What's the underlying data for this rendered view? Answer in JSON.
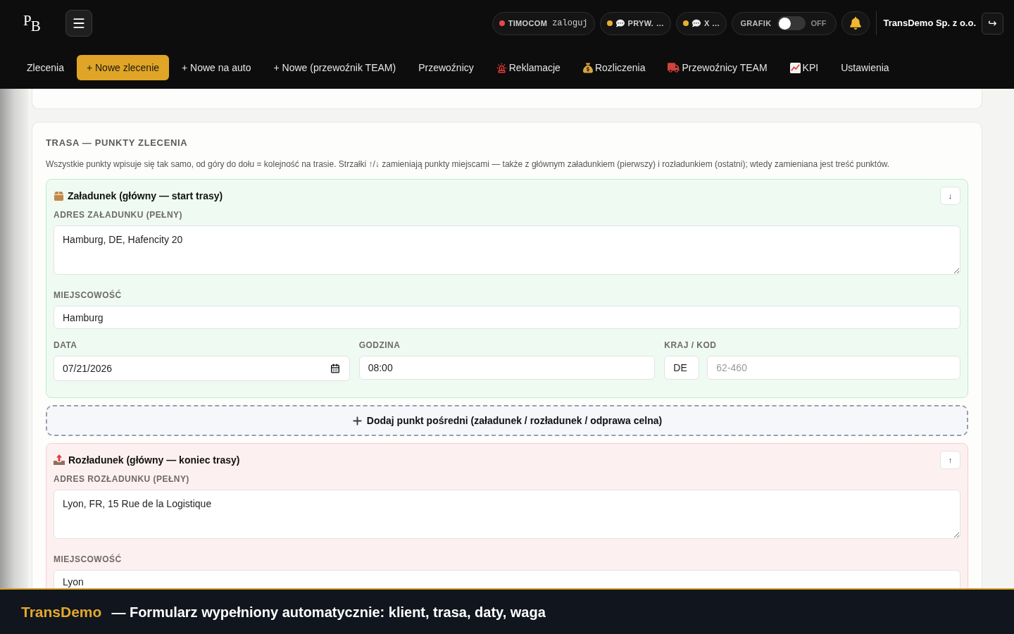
{
  "header": {
    "logo_letters": [
      "P",
      "B"
    ],
    "pills": [
      {
        "kind": "status",
        "color": "#e5484d",
        "label": "TIMOCOM",
        "value": "zaloguj"
      },
      {
        "kind": "chat",
        "color": "#e8b130",
        "label": "PRYW. …"
      },
      {
        "kind": "chat",
        "color": "#e8b130",
        "label": "X …"
      }
    ],
    "schedule": {
      "label": "GRAFIK",
      "on": false,
      "state_label": "OFF"
    },
    "company": "TransDemo Sp. z o.o.",
    "logout_glyph": "↪"
  },
  "nav": [
    {
      "kind": "plain",
      "label": "Zlecenia",
      "selected": false
    },
    {
      "kind": "plain",
      "label": "+ Nowe zlecenie",
      "selected": true
    },
    {
      "kind": "plain",
      "label": "+ Nowe na auto",
      "selected": false
    },
    {
      "kind": "plain",
      "label": "+ Nowe (przewoźnik TEAM)",
      "selected": false
    },
    {
      "kind": "plain",
      "label": "Przewoźnicy",
      "selected": false
    },
    {
      "kind": "siren",
      "label": "Reklamacje",
      "selected": false
    },
    {
      "kind": "money_bag",
      "label": "Rozliczenia",
      "selected": false
    },
    {
      "kind": "truck",
      "label": "Przewoźnicy TEAM",
      "selected": false
    },
    {
      "kind": "chart",
      "label": "KPI",
      "selected": false
    },
    {
      "kind": "plain",
      "label": "Ustawienia",
      "selected": false
    }
  ],
  "route": {
    "title": "TRASA — PUNKTY ZLECENIA",
    "description": "Wszystkie punkty wpisuje się tak samo, od góry do dołu = kolejność na trasie. Strzałki ↑/↓ zamieniają punkty miejscami — także z głównym załadunkiem (pierwszy) i rozładunkiem (ostatni); wtedy zamieniana jest treść punktów.",
    "stops": [
      {
        "kind": "loading",
        "title": "Załadunek (główny — start trasy)",
        "move": "↓",
        "address_label": "ADRES ZAŁADUNKU (PEŁNY)",
        "address": "Hamburg, DE, Hafencity 20",
        "city_label": "MIEJSCOWOŚĆ",
        "city": "Hamburg",
        "date_label": "DATA",
        "date": "07/21/2026",
        "time_label": "GODZINA",
        "time": "08:00",
        "country_label": "KRAJ / KOD",
        "country": "DE",
        "postcode_placeholder": "62-460"
      },
      {
        "kind": "unloading",
        "title": "Rozładunek (główny — koniec trasy)",
        "move": "↑",
        "address_label": "ADRES ROZŁADUNKU (PEŁNY)",
        "address": "Lyon, FR, 15 Rue de la Logistique",
        "city_label": "MIEJSCOWOŚĆ",
        "city": "Lyon"
      }
    ],
    "add_stop": "Dodaj punkt pośredni (załadunek / rozładunek / odprawa celna)"
  },
  "banner": {
    "brand": "TransDemo",
    "text": "— Formularz wypełniony automatycznie: klient, trasa, daty, waga"
  }
}
